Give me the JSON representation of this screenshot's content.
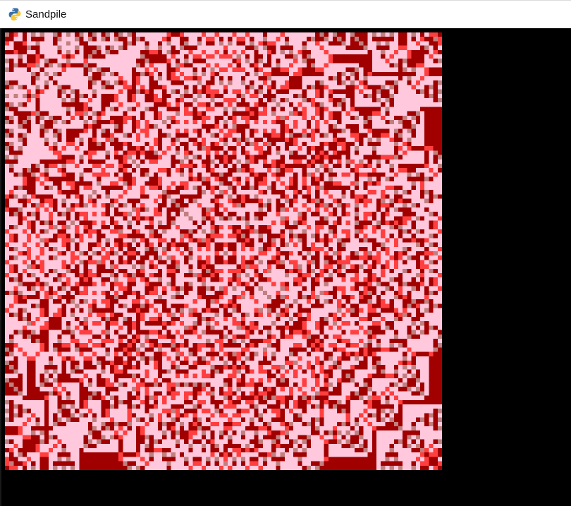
{
  "window": {
    "title": "Sandpile",
    "icon": "python-snake-icon"
  },
  "sandpile": {
    "grid_size": 100,
    "palette": {
      "0": "#c08080",
      "1": "#ff3f3f",
      "2": "#a00000",
      "3": "#ffc8dc"
    },
    "background": "#000000"
  }
}
